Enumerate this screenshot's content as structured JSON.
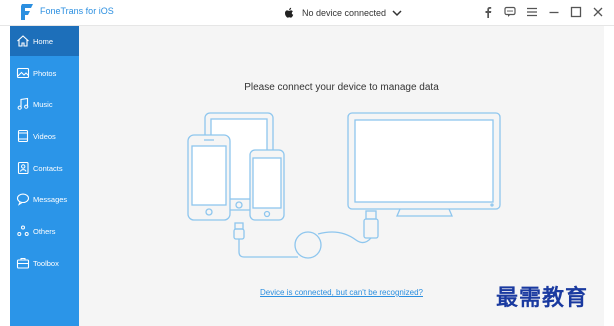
{
  "app": {
    "title": "FoneTrans for iOS",
    "brand_color": "#2b8fe0"
  },
  "device_selector": {
    "value": "No device connected"
  },
  "window_controls": [
    "facebook-icon",
    "feedback-icon",
    "menu-icon",
    "minimize-icon",
    "maximize-icon",
    "close-icon"
  ],
  "sidebar": {
    "color": "#2b95e8",
    "active_color": "#1d6fba",
    "items": [
      {
        "label": "Home",
        "icon": "home-icon",
        "active": true
      },
      {
        "label": "Photos",
        "icon": "photos-icon",
        "active": false
      },
      {
        "label": "Music",
        "icon": "music-icon",
        "active": false
      },
      {
        "label": "Videos",
        "icon": "videos-icon",
        "active": false
      },
      {
        "label": "Contacts",
        "icon": "contacts-icon",
        "active": false
      },
      {
        "label": "Messages",
        "icon": "messages-icon",
        "active": false
      },
      {
        "label": "Others",
        "icon": "others-icon",
        "active": false
      },
      {
        "label": "Toolbox",
        "icon": "toolbox-icon",
        "active": false
      }
    ]
  },
  "main": {
    "prompt": "Please connect your device to manage data",
    "help_link": "Device is connected, but can't be recognized?"
  },
  "watermark": "最需教育"
}
